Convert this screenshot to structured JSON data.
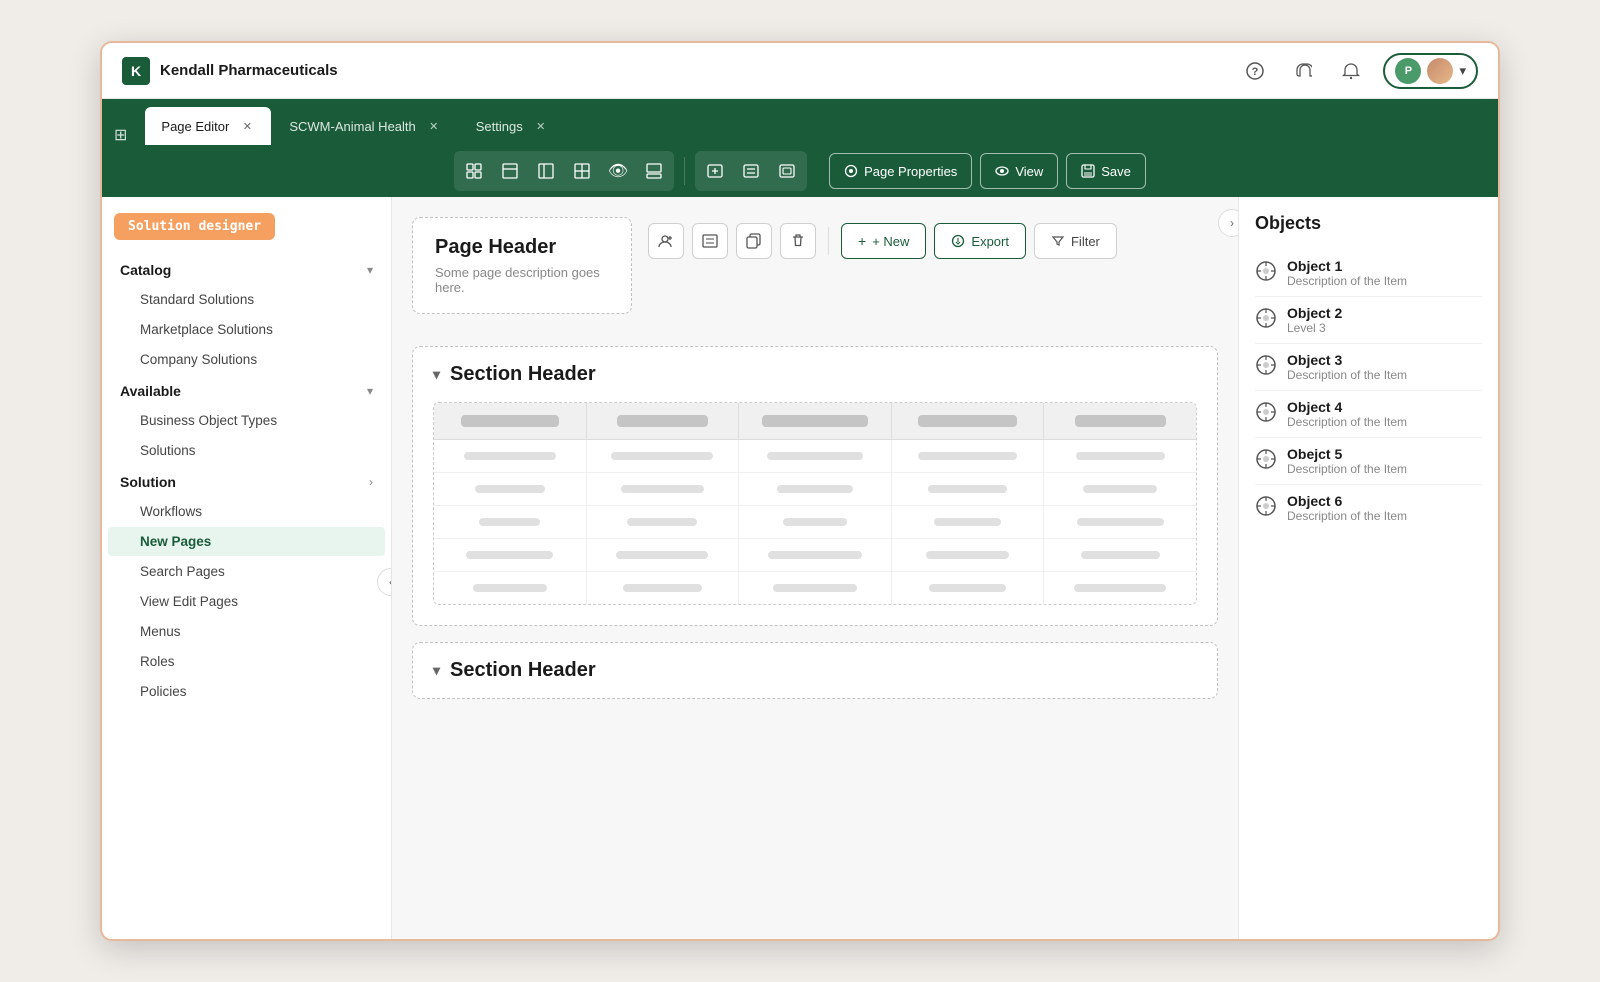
{
  "app": {
    "logo": "K",
    "title": "Kendall Pharmaceuticals"
  },
  "titleBar": {
    "helpIcon": "?",
    "headsetIcon": "🎧",
    "bellIcon": "🔔",
    "user1Initial": "P",
    "dropdownIcon": "▾"
  },
  "tabs": [
    {
      "label": "Page Editor",
      "active": true,
      "closeable": true
    },
    {
      "label": "SCWM-Animal Health",
      "active": false,
      "closeable": true
    },
    {
      "label": "Settings",
      "active": false,
      "closeable": true
    }
  ],
  "toolbar": {
    "pagePropertiesLabel": "Page Properties",
    "viewLabel": "View",
    "saveLabel": "Save"
  },
  "sidebar": {
    "badge": "Solution designer",
    "groups": [
      {
        "label": "Catalog",
        "expanded": true,
        "items": [
          "Standard Solutions",
          "Marketplace Solutions",
          "Company Solutions"
        ]
      },
      {
        "label": "Available",
        "expanded": true,
        "items": [
          "Business Object Types",
          "Solutions"
        ]
      },
      {
        "label": "Solution",
        "expanded": true,
        "items": [
          "Workflows",
          "New Pages",
          "Search Pages",
          "View Edit Pages",
          "Menus",
          "Roles",
          "Policies"
        ]
      }
    ],
    "activeItem": "New Pages"
  },
  "canvas": {
    "pageHeader": {
      "title": "Page Header",
      "description": "Some page description goes here."
    },
    "actionBar": {
      "newLabel": "+ New",
      "exportLabel": "Export",
      "filterLabel": "Filter"
    },
    "sections": [
      {
        "title": "Section Header",
        "expanded": true
      },
      {
        "title": "Section Header",
        "expanded": true
      }
    ]
  },
  "objectsPanel": {
    "title": "Objects",
    "items": [
      {
        "name": "Object 1",
        "desc": "Description of the Item"
      },
      {
        "name": "Object 2",
        "desc": "Level 3"
      },
      {
        "name": "Object 3",
        "desc": "Description of the Item"
      },
      {
        "name": "Object 4",
        "desc": "Description of the Item"
      },
      {
        "name": "Obejct 5",
        "desc": "Description of the Item"
      },
      {
        "name": "Object 6",
        "desc": "Description of the Item"
      }
    ]
  }
}
